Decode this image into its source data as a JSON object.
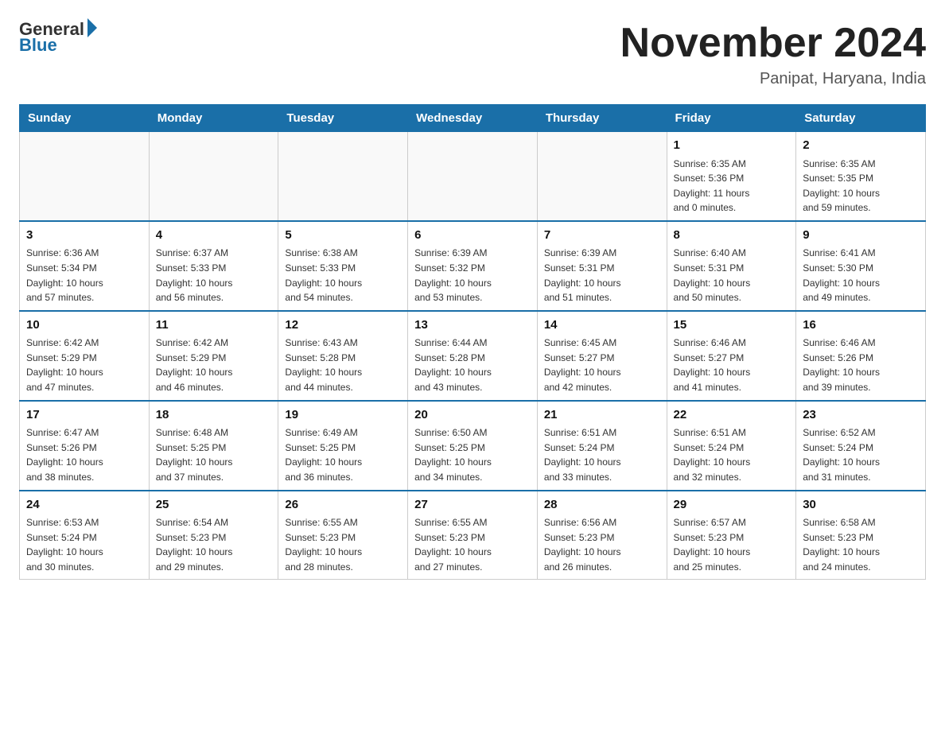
{
  "header": {
    "logo_general": "General",
    "logo_blue": "Blue",
    "month_title": "November 2024",
    "location": "Panipat, Haryana, India"
  },
  "weekdays": [
    "Sunday",
    "Monday",
    "Tuesday",
    "Wednesday",
    "Thursday",
    "Friday",
    "Saturday"
  ],
  "weeks": [
    [
      {
        "day": "",
        "info": ""
      },
      {
        "day": "",
        "info": ""
      },
      {
        "day": "",
        "info": ""
      },
      {
        "day": "",
        "info": ""
      },
      {
        "day": "",
        "info": ""
      },
      {
        "day": "1",
        "info": "Sunrise: 6:35 AM\nSunset: 5:36 PM\nDaylight: 11 hours\nand 0 minutes."
      },
      {
        "day": "2",
        "info": "Sunrise: 6:35 AM\nSunset: 5:35 PM\nDaylight: 10 hours\nand 59 minutes."
      }
    ],
    [
      {
        "day": "3",
        "info": "Sunrise: 6:36 AM\nSunset: 5:34 PM\nDaylight: 10 hours\nand 57 minutes."
      },
      {
        "day": "4",
        "info": "Sunrise: 6:37 AM\nSunset: 5:33 PM\nDaylight: 10 hours\nand 56 minutes."
      },
      {
        "day": "5",
        "info": "Sunrise: 6:38 AM\nSunset: 5:33 PM\nDaylight: 10 hours\nand 54 minutes."
      },
      {
        "day": "6",
        "info": "Sunrise: 6:39 AM\nSunset: 5:32 PM\nDaylight: 10 hours\nand 53 minutes."
      },
      {
        "day": "7",
        "info": "Sunrise: 6:39 AM\nSunset: 5:31 PM\nDaylight: 10 hours\nand 51 minutes."
      },
      {
        "day": "8",
        "info": "Sunrise: 6:40 AM\nSunset: 5:31 PM\nDaylight: 10 hours\nand 50 minutes."
      },
      {
        "day": "9",
        "info": "Sunrise: 6:41 AM\nSunset: 5:30 PM\nDaylight: 10 hours\nand 49 minutes."
      }
    ],
    [
      {
        "day": "10",
        "info": "Sunrise: 6:42 AM\nSunset: 5:29 PM\nDaylight: 10 hours\nand 47 minutes."
      },
      {
        "day": "11",
        "info": "Sunrise: 6:42 AM\nSunset: 5:29 PM\nDaylight: 10 hours\nand 46 minutes."
      },
      {
        "day": "12",
        "info": "Sunrise: 6:43 AM\nSunset: 5:28 PM\nDaylight: 10 hours\nand 44 minutes."
      },
      {
        "day": "13",
        "info": "Sunrise: 6:44 AM\nSunset: 5:28 PM\nDaylight: 10 hours\nand 43 minutes."
      },
      {
        "day": "14",
        "info": "Sunrise: 6:45 AM\nSunset: 5:27 PM\nDaylight: 10 hours\nand 42 minutes."
      },
      {
        "day": "15",
        "info": "Sunrise: 6:46 AM\nSunset: 5:27 PM\nDaylight: 10 hours\nand 41 minutes."
      },
      {
        "day": "16",
        "info": "Sunrise: 6:46 AM\nSunset: 5:26 PM\nDaylight: 10 hours\nand 39 minutes."
      }
    ],
    [
      {
        "day": "17",
        "info": "Sunrise: 6:47 AM\nSunset: 5:26 PM\nDaylight: 10 hours\nand 38 minutes."
      },
      {
        "day": "18",
        "info": "Sunrise: 6:48 AM\nSunset: 5:25 PM\nDaylight: 10 hours\nand 37 minutes."
      },
      {
        "day": "19",
        "info": "Sunrise: 6:49 AM\nSunset: 5:25 PM\nDaylight: 10 hours\nand 36 minutes."
      },
      {
        "day": "20",
        "info": "Sunrise: 6:50 AM\nSunset: 5:25 PM\nDaylight: 10 hours\nand 34 minutes."
      },
      {
        "day": "21",
        "info": "Sunrise: 6:51 AM\nSunset: 5:24 PM\nDaylight: 10 hours\nand 33 minutes."
      },
      {
        "day": "22",
        "info": "Sunrise: 6:51 AM\nSunset: 5:24 PM\nDaylight: 10 hours\nand 32 minutes."
      },
      {
        "day": "23",
        "info": "Sunrise: 6:52 AM\nSunset: 5:24 PM\nDaylight: 10 hours\nand 31 minutes."
      }
    ],
    [
      {
        "day": "24",
        "info": "Sunrise: 6:53 AM\nSunset: 5:24 PM\nDaylight: 10 hours\nand 30 minutes."
      },
      {
        "day": "25",
        "info": "Sunrise: 6:54 AM\nSunset: 5:23 PM\nDaylight: 10 hours\nand 29 minutes."
      },
      {
        "day": "26",
        "info": "Sunrise: 6:55 AM\nSunset: 5:23 PM\nDaylight: 10 hours\nand 28 minutes."
      },
      {
        "day": "27",
        "info": "Sunrise: 6:55 AM\nSunset: 5:23 PM\nDaylight: 10 hours\nand 27 minutes."
      },
      {
        "day": "28",
        "info": "Sunrise: 6:56 AM\nSunset: 5:23 PM\nDaylight: 10 hours\nand 26 minutes."
      },
      {
        "day": "29",
        "info": "Sunrise: 6:57 AM\nSunset: 5:23 PM\nDaylight: 10 hours\nand 25 minutes."
      },
      {
        "day": "30",
        "info": "Sunrise: 6:58 AM\nSunset: 5:23 PM\nDaylight: 10 hours\nand 24 minutes."
      }
    ]
  ]
}
